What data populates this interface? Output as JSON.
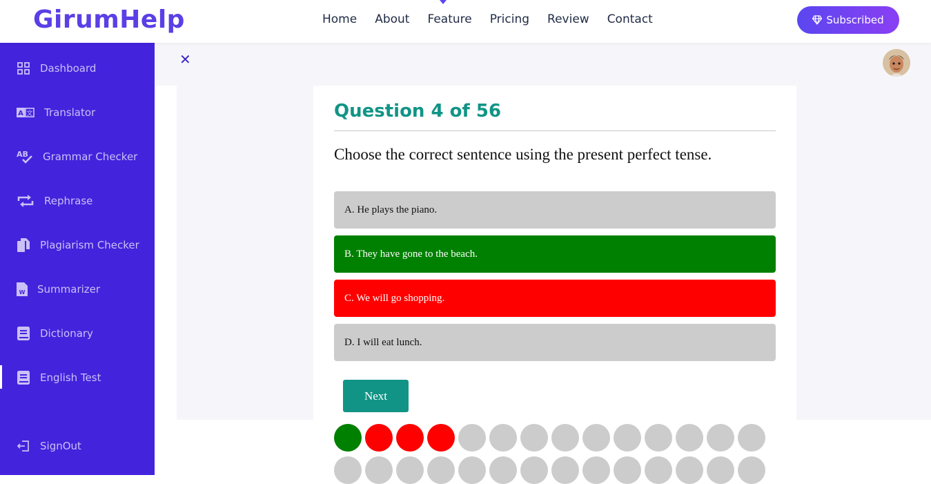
{
  "brand": {
    "name": "GirumHelp"
  },
  "nav": {
    "items": [
      "Home",
      "About",
      "Feature",
      "Pricing",
      "Review",
      "Contact"
    ]
  },
  "subscribe": {
    "label": "Subscribed",
    "icon": "diamond-icon"
  },
  "sidebar": {
    "items": [
      {
        "label": "Dashboard",
        "icon": "dashboard-icon"
      },
      {
        "label": "Translator",
        "icon": "translate-icon"
      },
      {
        "label": "Grammar Checker",
        "icon": "spellcheck-icon"
      },
      {
        "label": "Rephrase",
        "icon": "repeat-icon"
      },
      {
        "label": "Plagiarism Checker",
        "icon": "copy-icon"
      },
      {
        "label": "Summarizer",
        "icon": "word-file-icon"
      },
      {
        "label": "Dictionary",
        "icon": "book-icon"
      },
      {
        "label": "English Test",
        "icon": "book-icon"
      }
    ],
    "active": "English Test",
    "signout": {
      "label": "SignOut",
      "icon": "signout-icon"
    }
  },
  "quiz": {
    "title": "Question 4 of 56",
    "question": "Choose the correct sentence using the present perfect tense.",
    "options": [
      {
        "label": "A. He plays the piano.",
        "state": "neutral"
      },
      {
        "label": "B. They have gone to the beach.",
        "state": "correct"
      },
      {
        "label": "C. We will go shopping.",
        "state": "wrong"
      },
      {
        "label": "D. I will eat lunch.",
        "state": "neutral"
      }
    ],
    "next_label": "Next",
    "progress": [
      "correct",
      "wrong",
      "wrong",
      "wrong",
      "unanswered",
      "unanswered",
      "unanswered",
      "unanswered",
      "unanswered",
      "unanswered",
      "unanswered",
      "unanswered",
      "unanswered",
      "unanswered",
      "unanswered",
      "unanswered",
      "unanswered",
      "unanswered",
      "unanswered",
      "unanswered",
      "unanswered",
      "unanswered",
      "unanswered",
      "unanswered",
      "unanswered",
      "unanswered",
      "unanswered",
      "unanswered"
    ]
  },
  "colors": {
    "brand": "#5b3fe6",
    "sidebar": "#4423dc",
    "teal": "#119486",
    "correct": "#008000",
    "wrong": "#ff0000",
    "neutral": "#cccccc"
  }
}
